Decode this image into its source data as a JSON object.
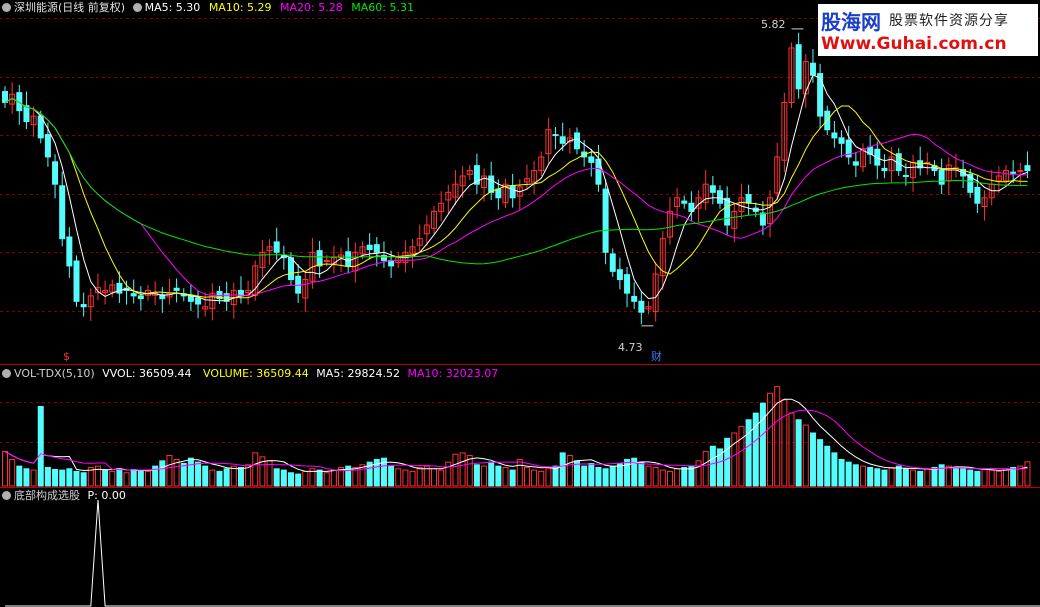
{
  "top_legend": {
    "stock": "深圳能源(日线 前复权)",
    "ma5": "MA5: 5.30",
    "ma10": "MA10: 5.29",
    "ma20": "MA20: 5.28",
    "ma60": "MA60: 5.31"
  },
  "vol_legend": {
    "name": "VOL-TDX(5,10)",
    "vvol": "VVOL: 36509.44",
    "volume": "VOLUME: 36509.44",
    "ma5": "MA5: 29824.52",
    "ma10": "MA10: 32023.07"
  },
  "ind_legend": {
    "name": "底部构成选股",
    "p": "P: 0.00"
  },
  "price_markers": {
    "high": "5.82",
    "low": "4.73",
    "cai": "财",
    "dollar": "$"
  },
  "watermark": {
    "brand": "股海网",
    "slogan": "股票软件资源分享",
    "url": "Www.Guhai.com.cn"
  },
  "colors": {
    "up": "#ff3232",
    "down": "#54fcfc",
    "ma5": "#ffffff",
    "ma10": "#ffff00",
    "ma20": "#ff00ff",
    "ma60": "#00e600",
    "grid": "#800000",
    "separator": "#c00000"
  },
  "chart_data": [
    {
      "type": "candlestick",
      "title": "深圳能源(日线 前复权)",
      "y_range": [
        4.7,
        5.86
      ],
      "series": [
        {
          "name": "MA5",
          "last": 5.3
        },
        {
          "name": "MA10",
          "last": 5.29
        },
        {
          "name": "MA20",
          "last": 5.28
        },
        {
          "name": "MA60",
          "last": 5.31
        }
      ],
      "annotations": [
        {
          "label": "5.82",
          "type": "high"
        },
        {
          "label": "4.73",
          "type": "low"
        }
      ],
      "closes": [
        5.55,
        5.58,
        5.52,
        5.48,
        5.5,
        5.42,
        5.35,
        5.25,
        5.05,
        4.95,
        4.82,
        4.8,
        4.84,
        4.87,
        4.86,
        4.88,
        4.85,
        4.86,
        4.84,
        4.83,
        4.86,
        4.85,
        4.83,
        4.85,
        4.86,
        4.84,
        4.82,
        4.81,
        4.8,
        4.85,
        4.83,
        4.82,
        4.86,
        4.84,
        4.86,
        4.95,
        5.0,
        5.02,
        5.0,
        4.98,
        4.9,
        4.85,
        4.9,
        5.0,
        4.95,
        4.97,
        4.98,
        4.99,
        4.95,
        5.0,
        5.02,
        5.01,
        5.0,
        4.97,
        4.95,
        4.98,
        5.0,
        5.02,
        5.05,
        5.1,
        5.15,
        5.18,
        5.22,
        5.25,
        5.28,
        5.3,
        5.25,
        5.28,
        5.22,
        5.2,
        5.25,
        5.2,
        5.24,
        5.27,
        5.3,
        5.35,
        5.45,
        5.43,
        5.4,
        5.42,
        5.38,
        5.35,
        5.33,
        5.25,
        5.0,
        4.93,
        4.9,
        4.85,
        4.82,
        4.78,
        4.8,
        4.92,
        5.05,
        5.15,
        5.2,
        5.18,
        5.15,
        5.2,
        5.25,
        5.22,
        5.18,
        5.1,
        5.15,
        5.2,
        5.18,
        5.15,
        5.1,
        5.2,
        5.35,
        5.55,
        5.75,
        5.6,
        5.7,
        5.65,
        5.5,
        5.45,
        5.42,
        5.4,
        5.35,
        5.32,
        5.38,
        5.36,
        5.32,
        5.3,
        5.35,
        5.3,
        5.28,
        5.33,
        5.31,
        5.33,
        5.3,
        5.25,
        5.32,
        5.31,
        5.28,
        5.22,
        5.18,
        5.2,
        5.25,
        5.28,
        5.3,
        5.29,
        5.3,
        5.3
      ]
    },
    {
      "type": "bar",
      "title": "VOL-TDX(5,10)",
      "series": [
        {
          "name": "VOLUME",
          "last": 36509.44
        },
        {
          "name": "MA5",
          "last": 29824.52
        },
        {
          "name": "MA10",
          "last": 32023.07
        }
      ],
      "values": [
        52000,
        40000,
        30000,
        26000,
        24000,
        120000,
        28000,
        25000,
        24000,
        26000,
        22000,
        20000,
        28000,
        30000,
        24000,
        22000,
        26000,
        20000,
        25000,
        24000,
        22000,
        30000,
        38000,
        46000,
        40000,
        34000,
        42000,
        36000,
        30000,
        24000,
        22000,
        26000,
        30000,
        28000,
        32000,
        50000,
        44000,
        38000,
        26000,
        24000,
        20000,
        18000,
        22000,
        26000,
        24000,
        20000,
        24000,
        28000,
        30000,
        28000,
        32000,
        36000,
        40000,
        42000,
        30000,
        26000,
        24000,
        22000,
        28000,
        30000,
        26000,
        24000,
        36000,
        48000,
        50000,
        46000,
        32000,
        30000,
        36000,
        30000,
        28000,
        24000,
        40000,
        28000,
        24000,
        22000,
        26000,
        30000,
        50000,
        46000,
        38000,
        30000,
        34000,
        28000,
        26000,
        30000,
        34000,
        40000,
        42000,
        36000,
        30000,
        28000,
        24000,
        22000,
        26000,
        28000,
        30000,
        38000,
        52000,
        60000,
        56000,
        72000,
        80000,
        90000,
        100000,
        110000,
        125000,
        140000,
        150000,
        130000,
        110000,
        100000,
        92000,
        80000,
        70000,
        60000,
        50000,
        40000,
        36000,
        32000,
        30000,
        28000,
        26000,
        24000,
        28000,
        30000,
        26000,
        24000,
        22000,
        26000,
        28000,
        32000,
        30000,
        28000,
        26000,
        24000,
        22000,
        26000,
        24000,
        22000,
        26000,
        28000,
        30000,
        36509
      ]
    },
    {
      "type": "line",
      "title": "底部构成选股",
      "series": [
        {
          "name": "P",
          "last": 0.0
        }
      ],
      "values": [
        0,
        0,
        0,
        0,
        0,
        0,
        0,
        0,
        0,
        0,
        0,
        0,
        0,
        1,
        0,
        0,
        0,
        0,
        0,
        0,
        0,
        0,
        0,
        0,
        0,
        0,
        0,
        0,
        0,
        0,
        0,
        0,
        0,
        0,
        0,
        0,
        0,
        0,
        0,
        0,
        0,
        0,
        0,
        0,
        0,
        0,
        0,
        0,
        0,
        0,
        0,
        0,
        0,
        0,
        0,
        0,
        0,
        0,
        0,
        0,
        0,
        0,
        0,
        0,
        0,
        0,
        0,
        0,
        0,
        0,
        0,
        0,
        0,
        0,
        0,
        0,
        0,
        0,
        0,
        0,
        0,
        0,
        0,
        0,
        0,
        0,
        0,
        0,
        0,
        0,
        0,
        0,
        0,
        0,
        0,
        0,
        0,
        0,
        0,
        0,
        0,
        0,
        0,
        0,
        0,
        0,
        0,
        0,
        0,
        0,
        0,
        0,
        0,
        0,
        0,
        0,
        0,
        0,
        0,
        0,
        0,
        0,
        0,
        0,
        0,
        0,
        0,
        0,
        0,
        0,
        0,
        0,
        0,
        0,
        0,
        0,
        0,
        0,
        0,
        0,
        0,
        0,
        0,
        0,
        0,
        0
      ]
    }
  ]
}
